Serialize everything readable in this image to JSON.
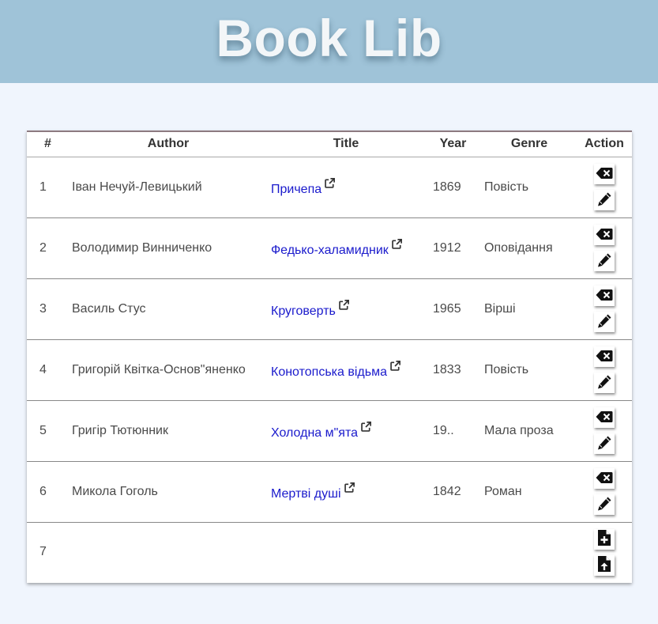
{
  "app": {
    "title": "Book Lib"
  },
  "columns": [
    "#",
    "Author",
    "Title",
    "Year",
    "Genre",
    "Action"
  ],
  "books": [
    {
      "num": "1",
      "author": "Іван Нечуй-Левицький",
      "title": "Причепа",
      "year": "1869",
      "genre": "Повість"
    },
    {
      "num": "2",
      "author": "Володимир Винниченко",
      "title": "Федько-халамидник",
      "year": "1912",
      "genre": "Оповідання"
    },
    {
      "num": "3",
      "author": "Василь Стус",
      "title": "Круговерть",
      "year": "1965",
      "genre": "Вірші"
    },
    {
      "num": "4",
      "author": "Григорій Квітка-Основ\"яненко",
      "title": "Конотопська відьма",
      "year": "1833",
      "genre": "Повість"
    },
    {
      "num": "5",
      "author": "Григір Тютюнник",
      "title": "Холодна м\"ята",
      "year": "19..",
      "genre": "Мала проза"
    },
    {
      "num": "6",
      "author": "Микола Гоголь",
      "title": "Мертві душі",
      "year": "1842",
      "genre": "Роман"
    }
  ],
  "new_row": {
    "num": "7"
  },
  "icons": {
    "delete": "backspace-delete-icon",
    "edit": "pencil-edit-icon",
    "external": "external-link-icon",
    "add": "file-add-icon",
    "upload": "file-upload-icon"
  },
  "colors": {
    "header_bg": "#9fc3d8",
    "page_bg": "#f0f5fd",
    "link": "#1a1acc"
  }
}
